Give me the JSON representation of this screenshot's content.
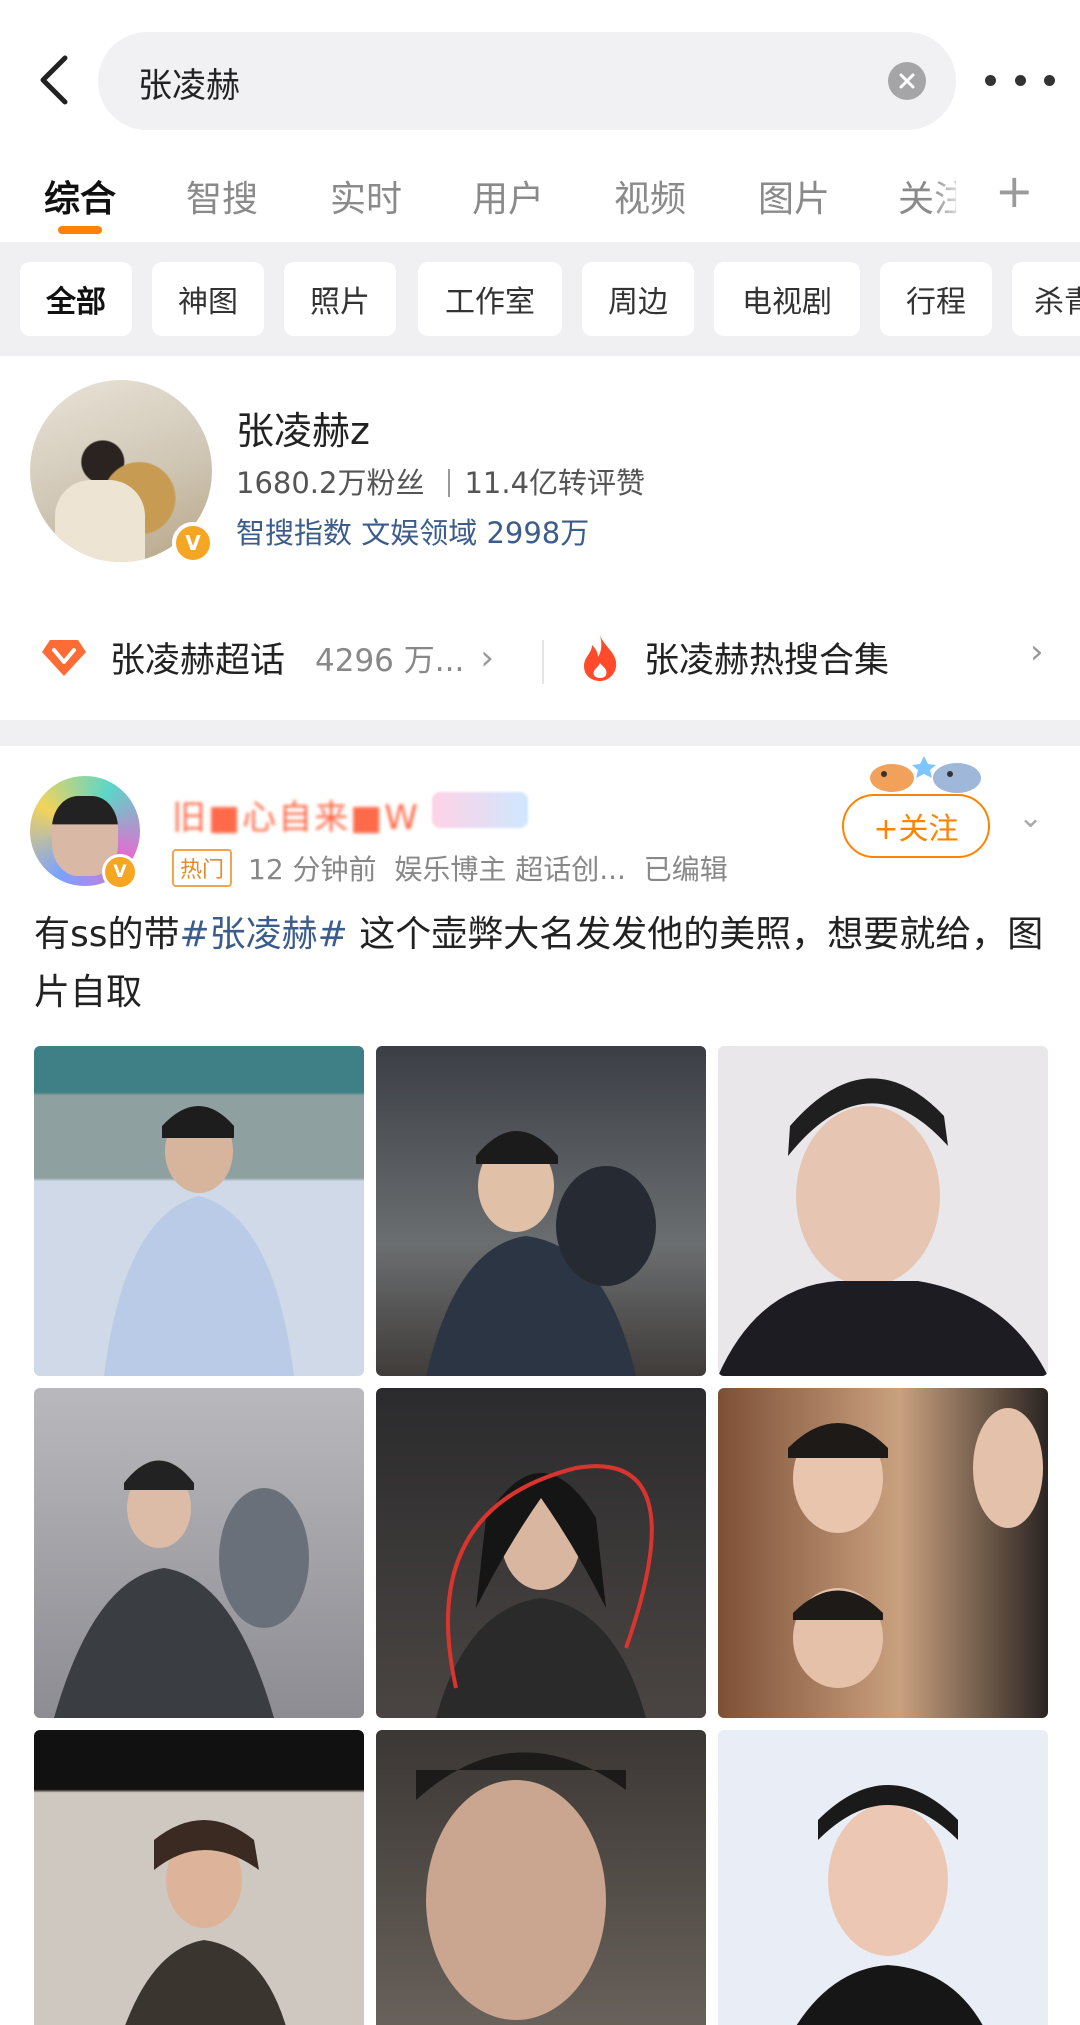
{
  "search": {
    "query": "张凌赫"
  },
  "tabs": [
    {
      "label": "综合",
      "active": true
    },
    {
      "label": "智搜"
    },
    {
      "label": "实时"
    },
    {
      "label": "用户"
    },
    {
      "label": "视频"
    },
    {
      "label": "图片"
    },
    {
      "label": "关注"
    }
  ],
  "chips": [
    {
      "label": "全部",
      "active": true
    },
    {
      "label": "神图"
    },
    {
      "label": "照片"
    },
    {
      "label": "工作室"
    },
    {
      "label": "周边"
    },
    {
      "label": "电视剧"
    },
    {
      "label": "行程"
    },
    {
      "label": "杀青"
    }
  ],
  "profile": {
    "name": "张凌赫z",
    "fans": "1680.2万粉丝",
    "engagement": "11.4亿转评赞",
    "index_label": "智搜指数 文娱领域",
    "index_value": "2998万",
    "supertopic": {
      "title": "张凌赫超话",
      "count": "4296 万..."
    },
    "hotsearch": {
      "title": "张凌赫热搜合集"
    }
  },
  "post": {
    "hot_tag": "热门",
    "time": "12 分钟前",
    "source": "娱乐博主 超话创...",
    "edited": "已编辑",
    "follow_label": "+关注",
    "text_prefix": "有ss的带",
    "hashtag": "#张凌赫#",
    "text_suffix": " 这个壶弊大名发发他的美照，想要就给，图片自取"
  },
  "colors": {
    "accent": "#ff8200",
    "link": "#3c5d8c",
    "band": "#f0f0f2"
  },
  "icons": [
    "back-arrow-icon",
    "clear-icon",
    "more-icon",
    "plus-icon",
    "verified-icon",
    "supertopic-gem-icon",
    "fire-icon",
    "chevron-right-icon",
    "chevron-down-icon"
  ]
}
